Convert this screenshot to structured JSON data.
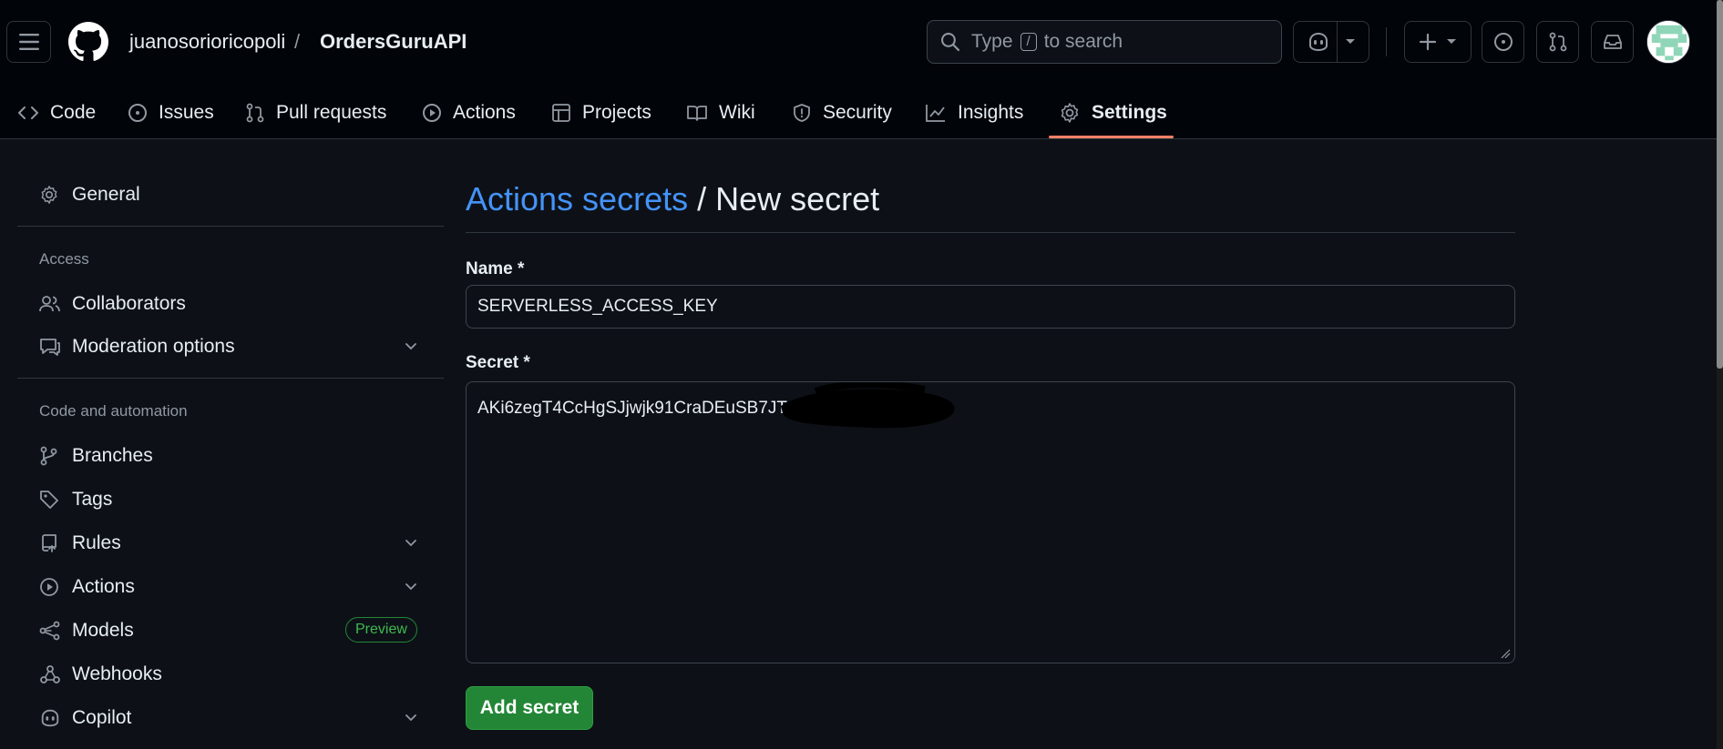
{
  "header": {
    "owner": "juanosorioricopoli",
    "separator": "/",
    "repo": "OrdersGuruAPI",
    "search": {
      "prefix": "Type",
      "key": "/",
      "suffix": "to search"
    }
  },
  "repo_nav": {
    "items": [
      {
        "label": "Code",
        "icon": "code-icon"
      },
      {
        "label": "Issues",
        "icon": "issue-icon"
      },
      {
        "label": "Pull requests",
        "icon": "pull-request-icon"
      },
      {
        "label": "Actions",
        "icon": "play-icon"
      },
      {
        "label": "Projects",
        "icon": "table-icon"
      },
      {
        "label": "Wiki",
        "icon": "book-icon"
      },
      {
        "label": "Security",
        "icon": "shield-icon"
      },
      {
        "label": "Insights",
        "icon": "graph-icon"
      },
      {
        "label": "Settings",
        "icon": "gear-icon",
        "active": true
      }
    ]
  },
  "sidebar": {
    "general": "General",
    "access_heading": "Access",
    "collaborators": "Collaborators",
    "moderation": "Moderation options",
    "code_heading": "Code and automation",
    "branches": "Branches",
    "tags": "Tags",
    "rules": "Rules",
    "actions": "Actions",
    "models": "Models",
    "models_badge": "Preview",
    "webhooks": "Webhooks",
    "copilot": "Copilot"
  },
  "main": {
    "breadcrumb_link": "Actions secrets",
    "breadcrumb_rest": " / New secret",
    "name_label": "Name *",
    "name_value": "SERVERLESS_ACCESS_KEY",
    "secret_label": "Secret *",
    "secret_value": "AKi6zegT4CcHgSJjwjk91CraDEuSB7JT",
    "submit": "Add secret"
  },
  "colors": {
    "background": "#0d1117",
    "header": "#010409",
    "link": "#4493f8",
    "active_underline": "#f78166",
    "primary_button": "#238636"
  }
}
